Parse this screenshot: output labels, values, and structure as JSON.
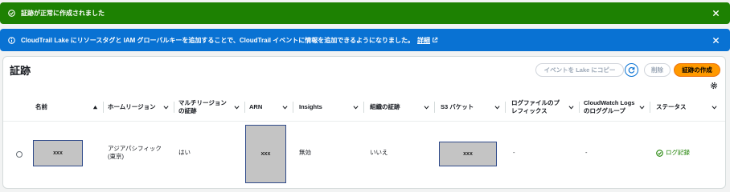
{
  "flash_success": {
    "text": "証跡が正常に作成されました"
  },
  "flash_info": {
    "text": "CloudTrail Lake にリソースタグと IAM グローバルキーを追加することで、CloudTrail イベントに情報を追加できるようになりました。",
    "link": "詳細"
  },
  "panel": {
    "title": "証跡",
    "buttons": {
      "lake_copy": "イベントを Lake にコピー",
      "delete": "削除",
      "create": "証跡の作成"
    }
  },
  "table": {
    "columns": [
      {
        "line1": "名前",
        "line2": ""
      },
      {
        "line1": "ホームリージョン",
        "line2": ""
      },
      {
        "line1": "マルチリージョン",
        "line2": "の証跡"
      },
      {
        "line1": "ARN",
        "line2": ""
      },
      {
        "line1": "Insights",
        "line2": ""
      },
      {
        "line1": "組織の証跡",
        "line2": ""
      },
      {
        "line1": "S3 バケット",
        "line2": ""
      },
      {
        "line1": "ログファイルのプ",
        "line2": "レフィックス"
      },
      {
        "line1": "CloudWatch Logs",
        "line2": "のロググループ"
      },
      {
        "line1": "ステータス",
        "line2": ""
      }
    ],
    "row": {
      "name": "xxx",
      "home_region_line1": "アジアパシフィック",
      "home_region_line2": "(東京)",
      "multi_region": "はい",
      "arn": "xxx",
      "insights": "無効",
      "org_trail": "いいえ",
      "s3_bucket": "xxx",
      "prefix": "-",
      "cw_logs": "-",
      "status": "ログ記録"
    }
  },
  "colors": {
    "success": "#1d8102",
    "info": "#0972d3",
    "primary_button": "#ff9900"
  },
  "icons": [
    "check-circle-icon",
    "info-circle-icon",
    "close-icon",
    "external-link-icon",
    "refresh-icon",
    "gear-icon",
    "sort-ascending-icon",
    "sort-icon",
    "status-success-icon"
  ]
}
